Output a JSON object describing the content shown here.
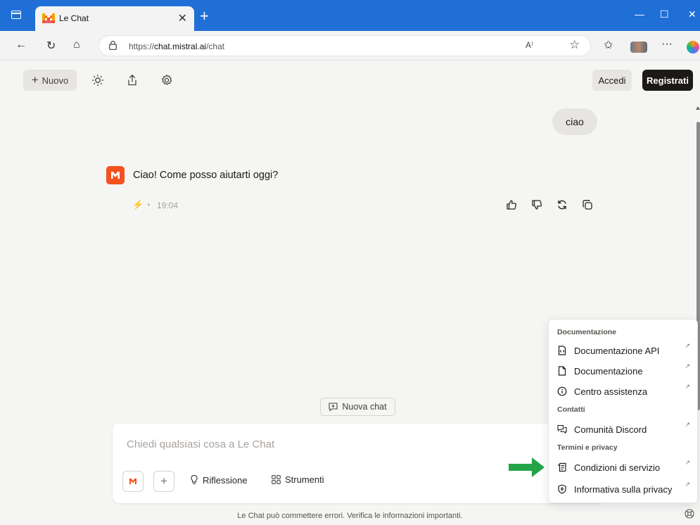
{
  "browser": {
    "tab_title": "Le Chat",
    "tab_close": "✕",
    "new_tab": "+",
    "url_prefix": "https://",
    "url_host": "chat.mistral.ai",
    "url_path": "/chat",
    "read_aloud": "A⁾",
    "window_controls": [
      "—",
      "☐",
      "✕"
    ]
  },
  "toolbar": {
    "new_label": "Nuovo",
    "login_label": "Accedi",
    "register_label": "Registrati"
  },
  "conversation": {
    "user_message": "ciao",
    "assistant_message": "Ciao! Come posso aiutarti oggi?",
    "time": "19:04"
  },
  "new_chat_label": "Nuova chat",
  "composer": {
    "placeholder": "Chiedi qualsiasi cosa a Le Chat",
    "reflection_label": "Riflessione",
    "tools_label": "Strumenti"
  },
  "footer_note": "Le Chat può commettere errori. Verifica le informazioni importanti.",
  "help_menu": {
    "sections": [
      {
        "title": "Documentazione",
        "items": [
          {
            "label": "Documentazione API",
            "icon": "code-doc-icon"
          },
          {
            "label": "Documentazione",
            "icon": "document-icon"
          },
          {
            "label": "Centro assistenza",
            "icon": "info-icon"
          }
        ]
      },
      {
        "title": "Contatti",
        "items": [
          {
            "label": "Comunità Discord",
            "icon": "chat-icon"
          }
        ]
      },
      {
        "title": "Termini e privacy",
        "items": [
          {
            "label": "Condizioni di servizio",
            "icon": "scroll-icon"
          },
          {
            "label": "Informativa sulla privacy",
            "icon": "shield-icon"
          }
        ]
      }
    ],
    "external_glyph": "↗"
  },
  "colors": {
    "browser_blue": "#1f6fd6",
    "mistral_orange": "#f4511e",
    "register_bg": "#1c1917",
    "annotation_arrow": "#22a447"
  }
}
